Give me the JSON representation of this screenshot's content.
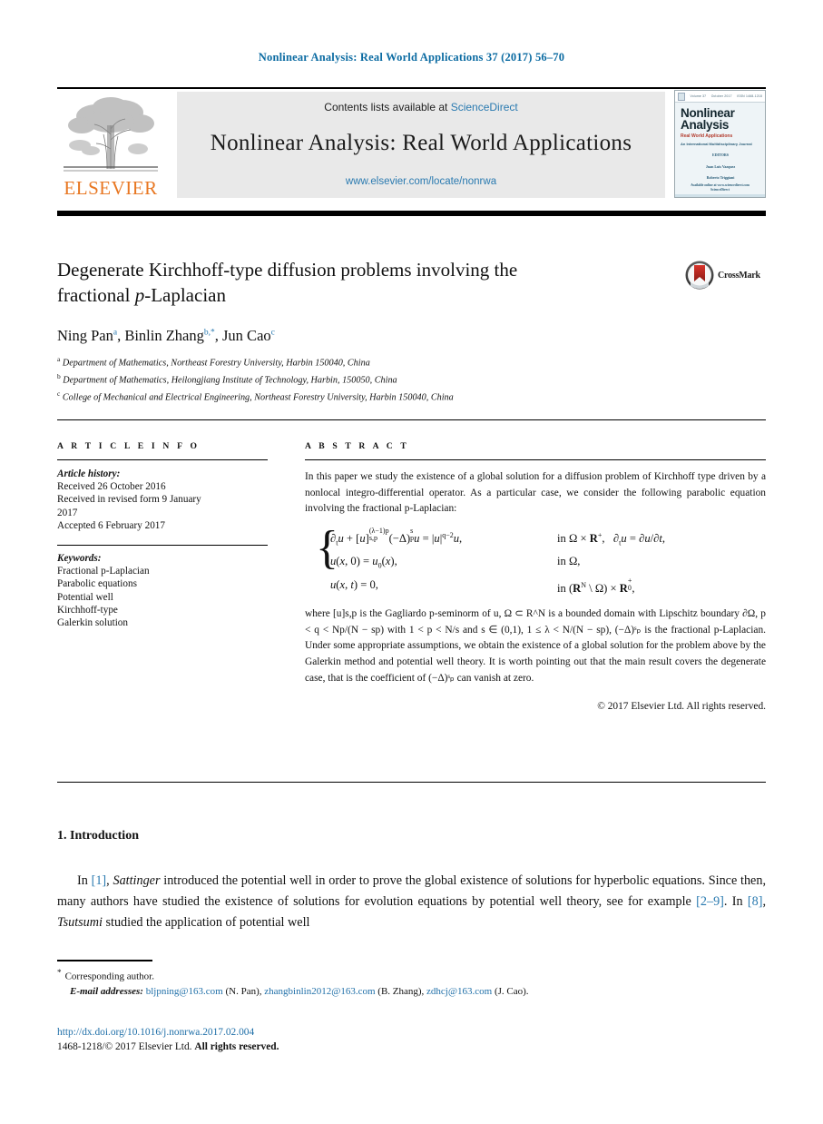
{
  "running_head": "Nonlinear Analysis: Real World Applications 37 (2017) 56–70",
  "masthead": {
    "contents_prefix": "Contents lists available at ",
    "sciencedirect": "ScienceDirect",
    "journal_title": "Nonlinear Analysis: Real World Applications",
    "journal_url": "www.elsevier.com/locate/nonrwa",
    "publisher": "ELSEVIER",
    "cover": {
      "vol": "Volume 37",
      "date": "October 2017",
      "issn": "ISSN 1468-1218",
      "title_line1": "Nonlinear",
      "title_line2": "Analysis",
      "subtitle": "Real World Applications",
      "subtitle2": "An International Multidisciplinary Journal",
      "editors_label": "EDITORS",
      "editor1": "Juan Luis Vazquez",
      "editor2": "Roberto Triggiani",
      "footer1": "Available online at www.sciencedirect.com",
      "footer2": "ScienceDirect"
    }
  },
  "article": {
    "title_line1": "Degenerate Kirchhoff-type diffusion problems involving the",
    "title_line2_pre": "fractional ",
    "title_line2_ital": "p",
    "title_line2_post": "-Laplacian",
    "crossmark_label": "CrossMark",
    "authors": [
      {
        "name": "Ning Pan",
        "sup": "a"
      },
      {
        "name": "Binlin Zhang",
        "sup": "b,*"
      },
      {
        "name": "Jun Cao",
        "sup": "c"
      }
    ],
    "affiliations": [
      {
        "marker": "a",
        "text": "Department of Mathematics, Northeast Forestry University, Harbin 150040, China"
      },
      {
        "marker": "b",
        "text": "Department of Mathematics, Heilongjiang Institute of Technology, Harbin, 150050, China"
      },
      {
        "marker": "c",
        "text": "College of Mechanical and Electrical Engineering, Northeast Forestry University, Harbin 150040, China"
      }
    ]
  },
  "article_info": {
    "heading": "A R T I C L E   I N F O",
    "history_label": "Article history:",
    "history": [
      "Received 26 October 2016",
      "Received in revised form 9 January",
      "2017",
      "Accepted 6 February 2017"
    ],
    "keywords_label": "Keywords:",
    "keywords": [
      "Fractional p-Laplacian",
      "Parabolic equations",
      "Potential well",
      "Kirchhoff-type",
      "Galerkin solution"
    ]
  },
  "abstract": {
    "heading": "A B S T R A C T",
    "para1": "In this paper we study the existence of a global solution for a diffusion problem of Kirchhoff type driven by a nonlocal integro-differential operator. As a particular case, we consider the following parabolic equation involving the fractional p-Laplacian:",
    "equation": {
      "line1_lhs": "∂ₜu + [u]⁽ᵋ⁻¹⁾ᵖ(−Δ)ˢₚu = |u|^{q−2}u,",
      "line1_rhs": "in Ω × R⁺,   ∂ₜu = ∂u/∂t,",
      "line2_lhs": "u(x, 0) = u₀(x),",
      "line2_rhs": "in Ω,",
      "line3_lhs": "u(x, t) = 0,",
      "line3_rhs": "in (R^N \\ Ω) × R₀⁺,"
    },
    "para2": "where [u]s,p is the Gagliardo p-seminorm of u, Ω ⊂ R^N is a bounded domain with Lipschitz boundary ∂Ω, p < q < Np/(N − sp) with 1 < p < N/s and s ∈ (0,1), 1 ≤ λ < N/(N − sp), (−Δ)ˢₚ is the fractional p-Laplacian. Under some appropriate assumptions, we obtain the existence of a global solution for the problem above by the Galerkin method and potential well theory. It is worth pointing out that the main result covers the degenerate case, that is the coefficient of (−Δ)ˢₚ can vanish at zero.",
    "copyright": "© 2017 Elsevier Ltd. All rights reserved."
  },
  "introduction": {
    "heading": "1. Introduction",
    "body_part1": "In ",
    "ref1": "[1]",
    "body_part2": ", ",
    "author_ital": "Sattinger",
    "body_part3": " introduced the potential well in order to prove the global existence of solutions for hyperbolic equations. Since then, many authors have studied the existence of solutions for evolution equations by potential well theory, see for example ",
    "ref2": "[2–9]",
    "body_part4": ". In ",
    "ref3": "[8]",
    "body_part5": ", ",
    "author2_ital": "Tsutsumi",
    "body_part6": " studied the application of potential well"
  },
  "footer": {
    "corresponding_star": "*",
    "corresponding_text": "Corresponding author.",
    "email_label": "E-mail addresses:",
    "emails": [
      {
        "address": "bljpning@163.com",
        "owner": "(N. Pan)"
      },
      {
        "address": "zhangbinlin2012@163.com",
        "owner": "(B. Zhang)"
      },
      {
        "address": "zdhcj@163.com",
        "owner": "(J. Cao)"
      }
    ],
    "doi": "http://dx.doi.org/10.1016/j.nonrwa.2017.02.004",
    "issn_line_normal": "1468-1218/© 2017 Elsevier Ltd. ",
    "issn_line_bold": "All rights reserved."
  },
  "colors": {
    "link": "#1f6fa8",
    "running_head": "#0b6ba2",
    "elsevier_orange": "#e87722",
    "panel_bg": "#e9e9e9"
  }
}
